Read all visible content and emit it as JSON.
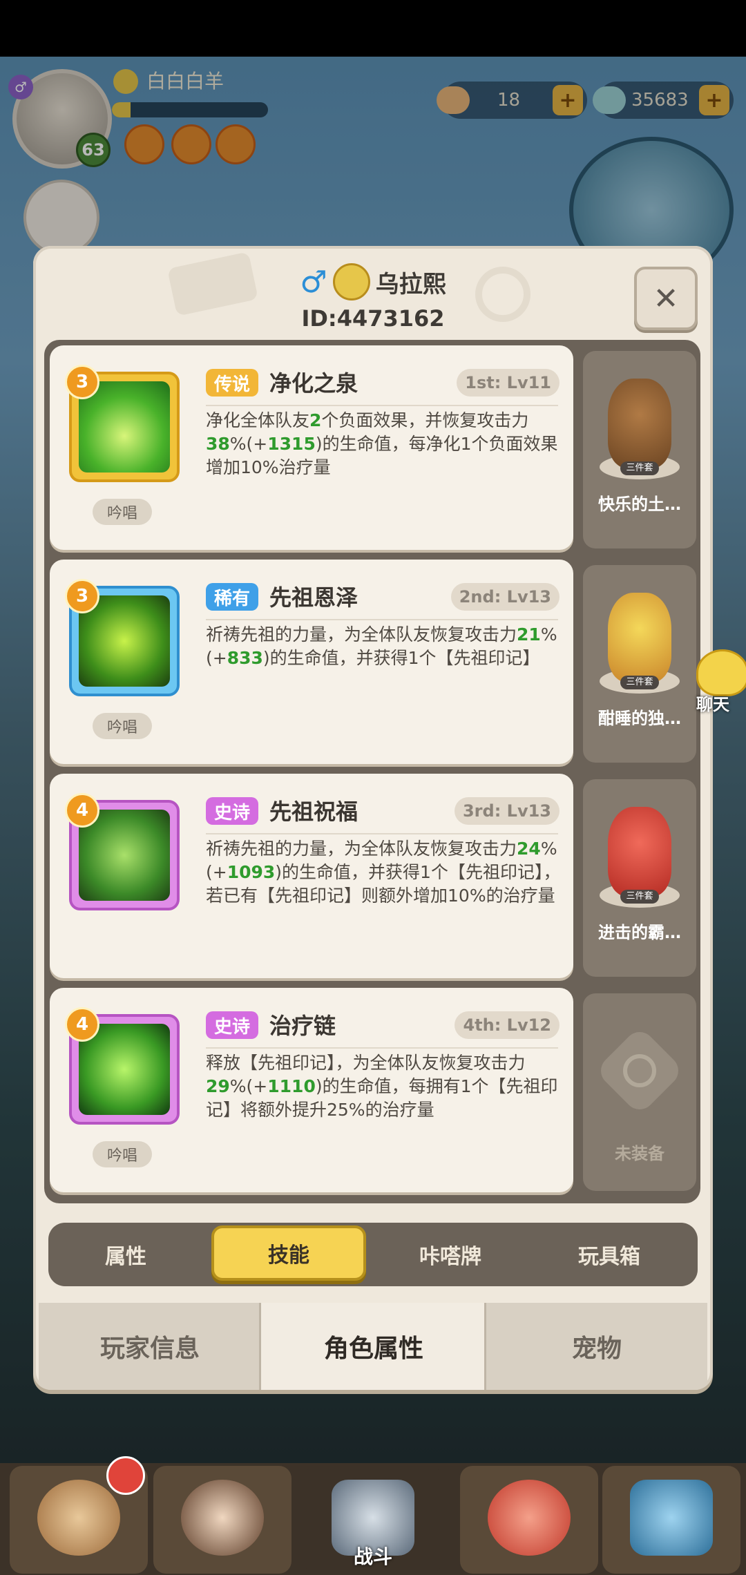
{
  "hud": {
    "gender_badge": "♂",
    "player_name": "白白白羊",
    "level": "63",
    "exp_fraction": 0.12,
    "resource_1": "18",
    "resource_2": "35683",
    "plus_label": "+"
  },
  "modal": {
    "gender_symbol": "♂",
    "player_name": "乌拉熙",
    "player_id": "ID:4473162",
    "close_symbol": "✕"
  },
  "skills": [
    {
      "level": "3",
      "rarity": "传说",
      "rarity_color": "#f2b637",
      "name": "净化之泉",
      "slot": "1st: Lv11",
      "desc_parts": [
        "净化全体队友",
        "2",
        "个负面效果，并恢复攻击力",
        "38",
        "%(+",
        "1315",
        ")的生命值，每净化1个负面效果增加10%治疗量"
      ],
      "chant": "吟唱"
    },
    {
      "level": "3",
      "rarity": "稀有",
      "rarity_color": "#3fa0e8",
      "name": "先祖恩泽",
      "slot": "2nd: Lv13",
      "desc_parts": [
        "祈祷先祖的力量，为全体队友恢复攻击力",
        "21",
        "%(+",
        "833",
        ")的生命值，并获得1个【先祖印记】",
        "",
        ""
      ],
      "chant": "吟唱"
    },
    {
      "level": "4",
      "rarity": "史诗",
      "rarity_color": "#d46ce0",
      "name": "先祖祝福",
      "slot": "3rd: Lv13",
      "desc_parts": [
        "祈祷先祖的力量，为全体队友恢复攻击力",
        "24",
        "%(+",
        "1093",
        ")的生命值，并获得1个【先祖印记】，若已有【先祖印记】则额外增加10%的治疗量",
        "",
        ""
      ],
      "chant": ""
    },
    {
      "level": "4",
      "rarity": "史诗",
      "rarity_color": "#d46ce0",
      "name": "治疗链",
      "slot": "4th: Lv12",
      "desc_parts": [
        "释放【先祖印记】，为全体队友恢复攻击力",
        "29",
        "%(+",
        "1110",
        ")的生命值，每拥有1个【先祖印记】将额外提升25%的治疗量",
        "",
        ""
      ],
      "chant": "吟唱"
    }
  ],
  "suits": [
    {
      "tag": "三件套",
      "name": "快乐的土…"
    },
    {
      "tag": "三件套",
      "name": "酣睡的独…"
    },
    {
      "tag": "三件套",
      "name": "进击的霸…"
    },
    {
      "tag": "",
      "name": "未装备"
    }
  ],
  "sub_tabs": [
    "属性",
    "技能",
    "咔嗒牌",
    "玩具箱"
  ],
  "main_tabs": [
    "玩家信息",
    "角色属性",
    "宠物"
  ],
  "chat_label": "聊天",
  "bottom_nav": {
    "battle_label": "战斗"
  }
}
